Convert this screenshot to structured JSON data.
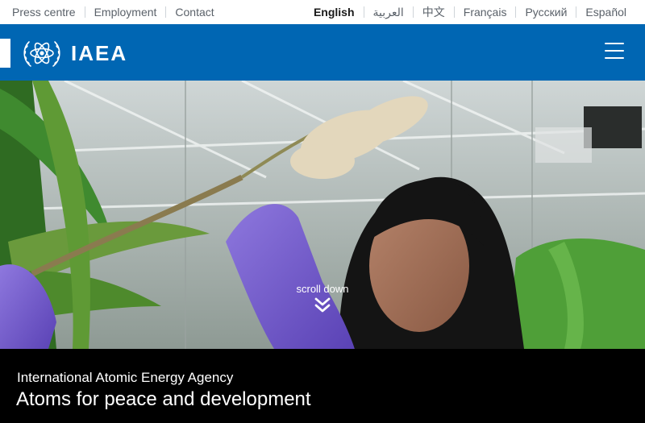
{
  "utility_nav": {
    "links": [
      "Press centre",
      "Employment",
      "Contact"
    ]
  },
  "languages": {
    "items": [
      "English",
      "العربية",
      "中文",
      "Français",
      "Русский",
      "Español"
    ],
    "active": "English"
  },
  "header": {
    "brand": "IAEA",
    "background_color": "#0066b3",
    "menu_icon": "hamburger-menu-icon"
  },
  "hero": {
    "scroll_label": "scroll down",
    "scroll_icon": "double-chevron-down-icon"
  },
  "caption": {
    "agency_name": "International Atomic Energy Agency",
    "tagline": "Atoms for peace and development"
  }
}
